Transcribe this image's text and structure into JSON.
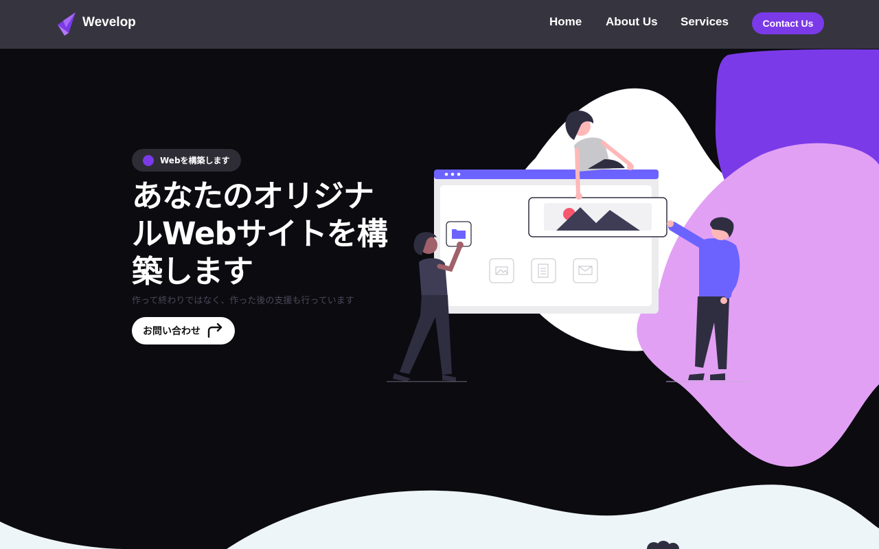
{
  "brand": {
    "name": "Wevelop",
    "logo_icon": "paper-plane-logo-icon",
    "accent": "#7b3ae8"
  },
  "nav": {
    "items": [
      {
        "label": "Home"
      },
      {
        "label": "About Us"
      },
      {
        "label": "Services"
      }
    ],
    "contact_label": "Contact Us"
  },
  "hero": {
    "badge": "Webを構築します",
    "title": "あなたのオリジナルWebサイトを構築します",
    "subtitle": "作って終わりではなく、作った後の支援も行っています",
    "cta_label": "お問い合わせ",
    "cta_icon": "arrow-turn-right-icon"
  },
  "colors": {
    "header_bg": "#36353f",
    "page_bg": "#0b0b10",
    "purple_dark": "#7b3ae8",
    "purple_light": "#e2a0f4",
    "browser_bar": "#6c63ff",
    "bottom_wave": "#eef5f8"
  }
}
